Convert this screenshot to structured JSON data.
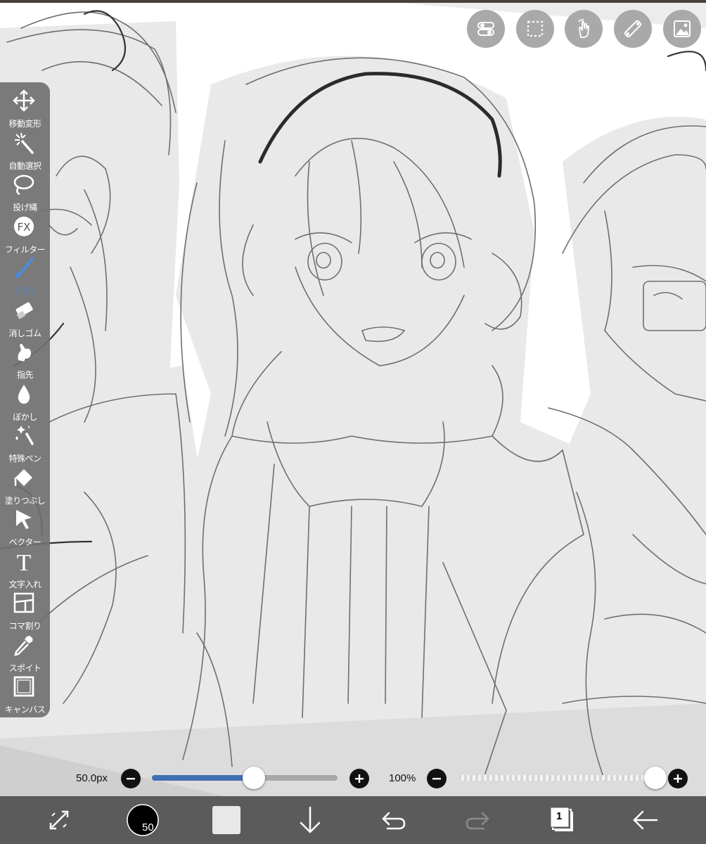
{
  "tools": [
    {
      "id": "move",
      "label": "移動変形",
      "icon": "move-arrows-icon"
    },
    {
      "id": "magic-wand",
      "label": "自動選択",
      "icon": "magic-wand-icon"
    },
    {
      "id": "lasso",
      "label": "投げ縄",
      "icon": "lasso-icon"
    },
    {
      "id": "filter",
      "label": "フィルター",
      "icon": "fx-icon",
      "icon_text": "FX"
    },
    {
      "id": "brush",
      "label": "ブラシ",
      "icon": "brush-icon",
      "active": true
    },
    {
      "id": "eraser",
      "label": "消しゴム",
      "icon": "eraser-icon"
    },
    {
      "id": "finger",
      "label": "指先",
      "icon": "finger-smudge-icon"
    },
    {
      "id": "blur",
      "label": "ぼかし",
      "icon": "water-drop-icon"
    },
    {
      "id": "special-pen",
      "label": "特殊ペン",
      "icon": "sparkle-pen-icon"
    },
    {
      "id": "fill",
      "label": "塗りつぶし",
      "icon": "paint-bucket-icon"
    },
    {
      "id": "vector",
      "label": "ベクター",
      "icon": "vector-cursor-icon"
    },
    {
      "id": "text",
      "label": "文字入れ",
      "icon": "text-t-icon"
    },
    {
      "id": "frame",
      "label": "コマ割り",
      "icon": "frame-divider-icon"
    },
    {
      "id": "eyedropper",
      "label": "スポイト",
      "icon": "eyedropper-icon"
    },
    {
      "id": "canvas",
      "label": "キャンバス",
      "icon": "canvas-square-icon"
    }
  ],
  "top_buttons": [
    "toggle-icon",
    "selection-icon",
    "gesture-hand-icon",
    "ruler-icon",
    "material-image-icon"
  ],
  "brush_size": {
    "value_text": "50.0px",
    "fraction": 0.55
  },
  "opacity": {
    "value_text": "100%",
    "fraction": 1.0
  },
  "bottom_bar": {
    "color_badge": "50",
    "layer_count": "1",
    "icons": [
      "transform-arrows-icon",
      "brush-color-icon",
      "secondary-color-icon",
      "import-down-icon",
      "undo-icon",
      "redo-icon",
      "layers-icon",
      "back-arrow-icon"
    ]
  },
  "colors": {
    "toolbar_bg": "#707070",
    "accent": "#3f6fb5",
    "active_label": "#4d8bd8",
    "bottom_bar": "#5b5b5b",
    "canvas_grey": "#e9e9e9"
  }
}
